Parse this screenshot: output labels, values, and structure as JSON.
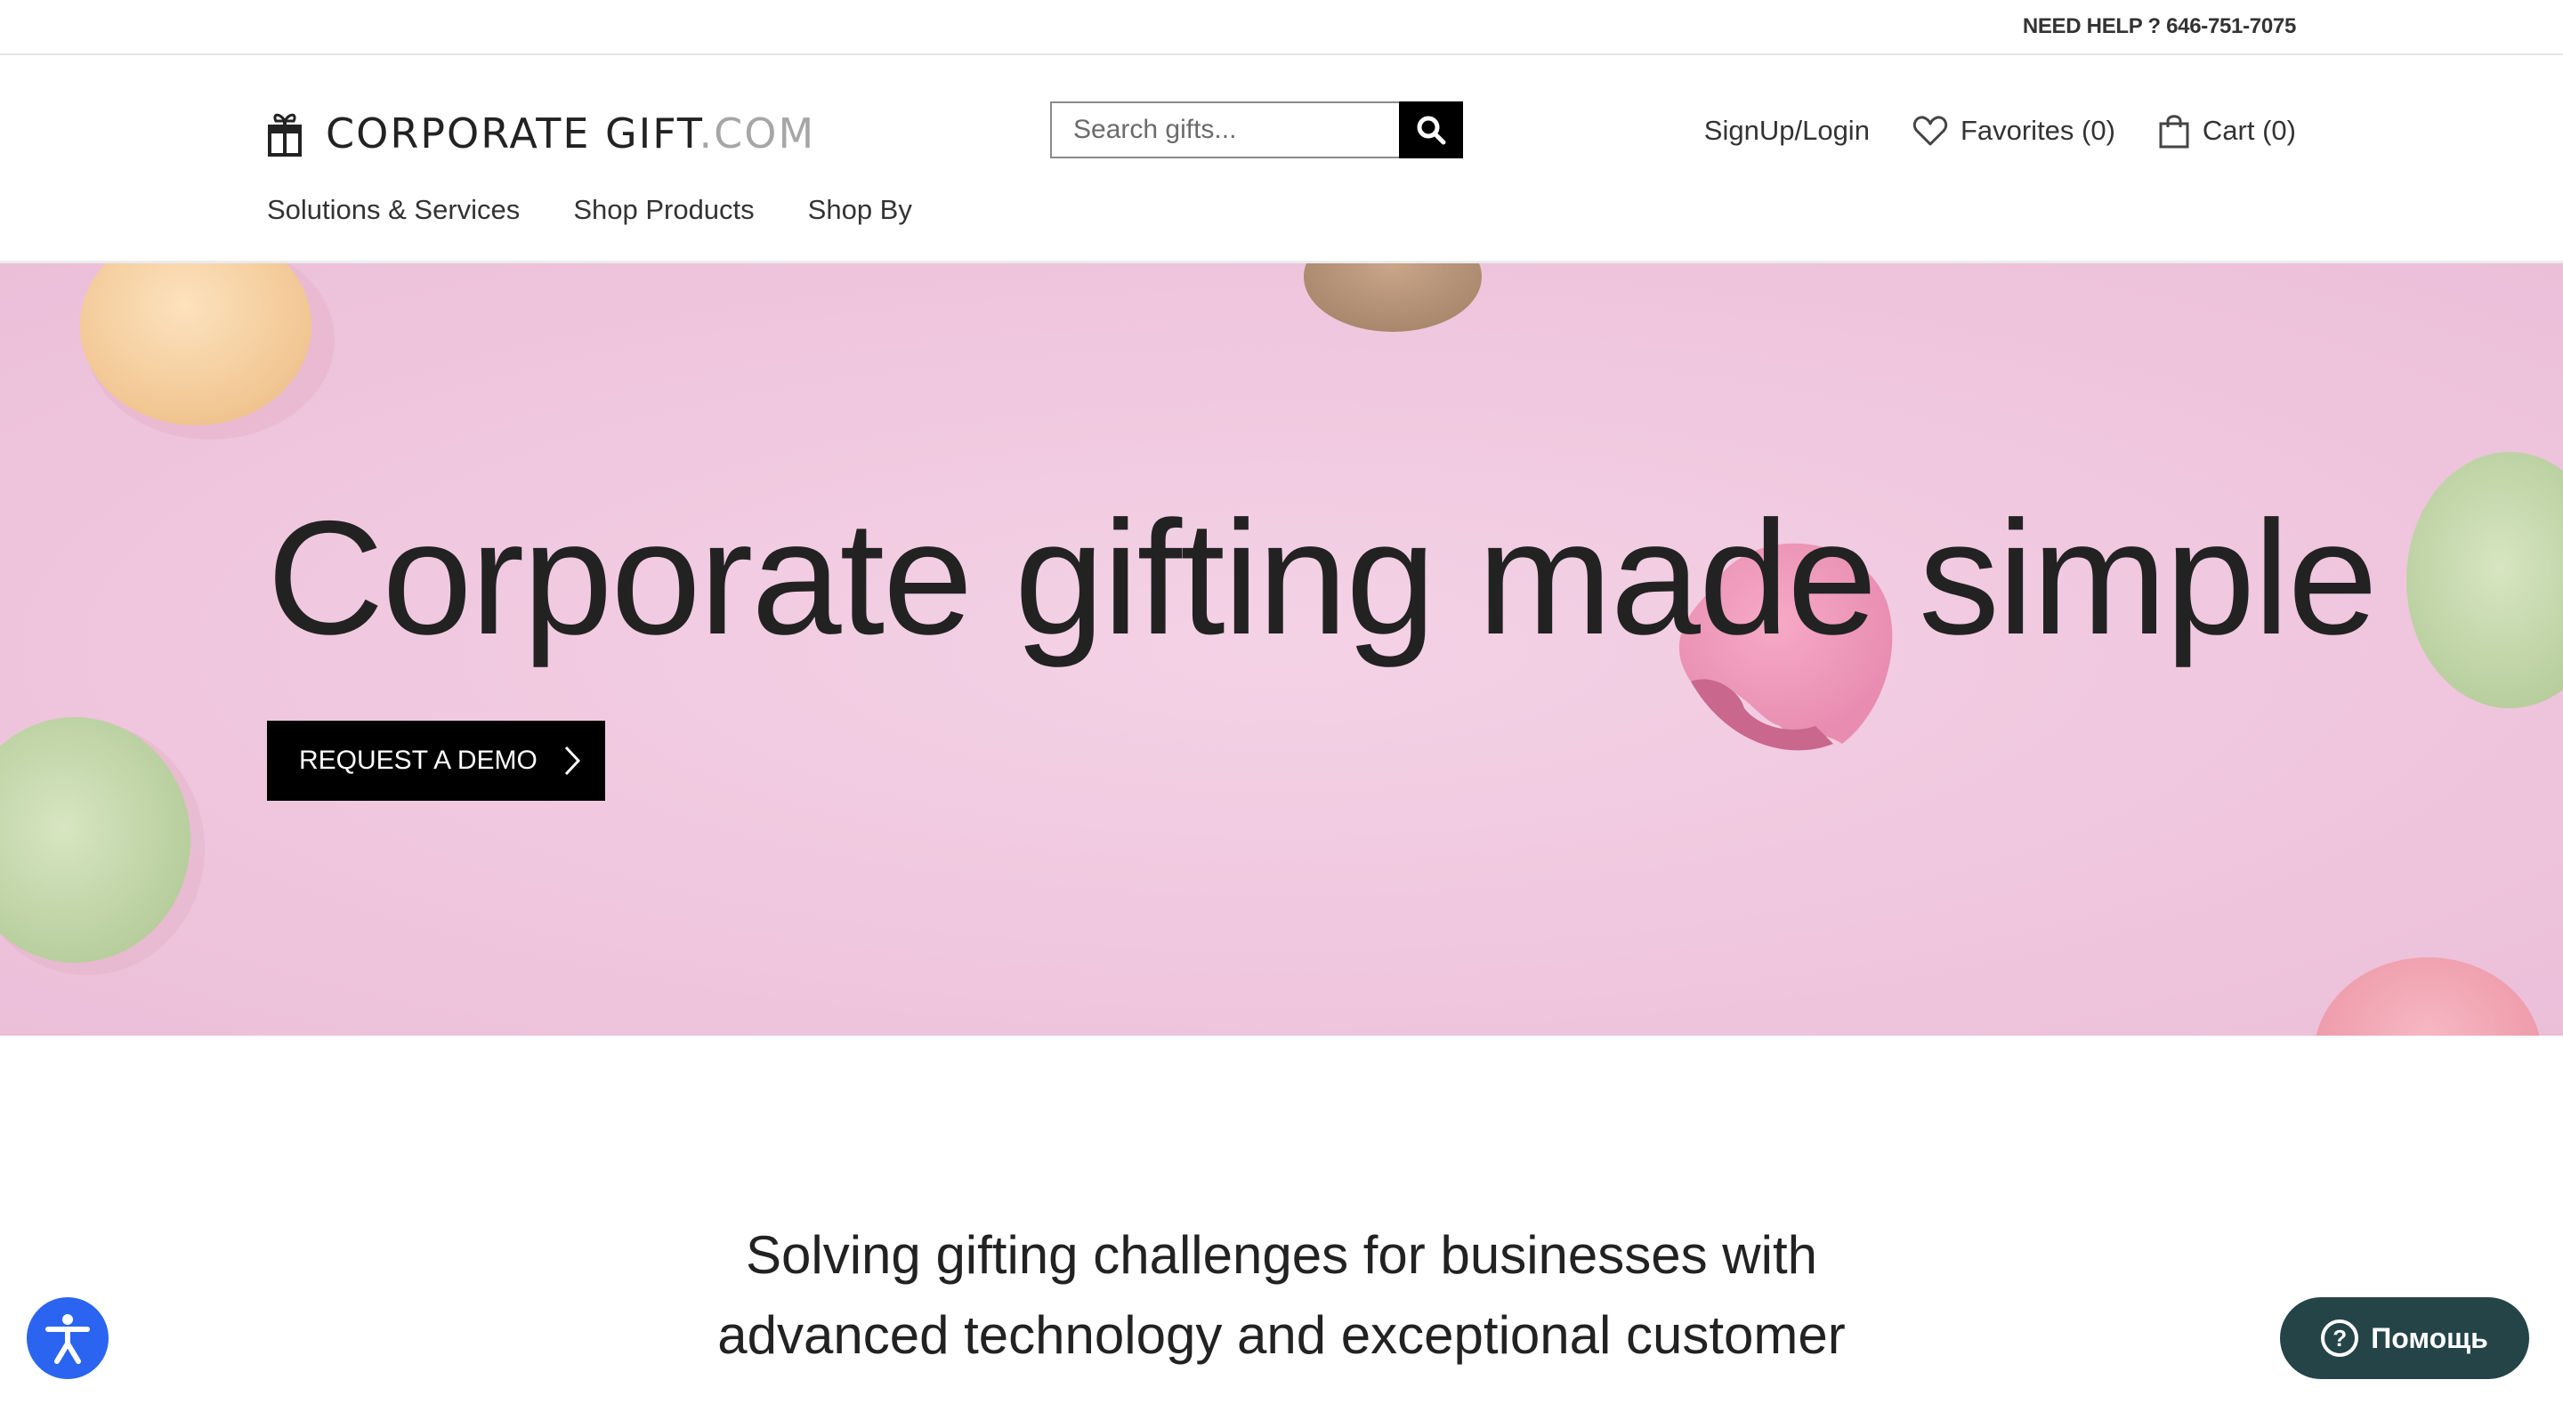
{
  "topbar": {
    "help_text": "NEED HELP ? 646-751-7075"
  },
  "logo": {
    "main": "CORPORATE GIFT",
    "suffix": ".COM",
    "icon": "gift-icon"
  },
  "search": {
    "placeholder": "Search gifts...",
    "icon": "search-icon"
  },
  "account": {
    "signup_login": "SignUp/Login",
    "favorites": "Favorites (0)",
    "cart": "Cart (0)"
  },
  "nav": {
    "items": [
      "Solutions & Services",
      "Shop Products",
      "Shop By"
    ]
  },
  "hero": {
    "title": "Corporate gifting made simple",
    "cta_label": "REQUEST A DEMO"
  },
  "tagline": {
    "line1": "Solving gifting challenges for businesses with",
    "line2": "advanced technology and exceptional customer",
    "line3": "..."
  },
  "chat": {
    "label": "Помощь",
    "icon": "question-icon"
  },
  "accessibility": {
    "icon": "accessibility-icon"
  },
  "colors": {
    "hero_bg": "#f2cde2",
    "button_bg": "#000000",
    "chat_bg": "#244448",
    "a11y_bg": "#2b64f0"
  }
}
